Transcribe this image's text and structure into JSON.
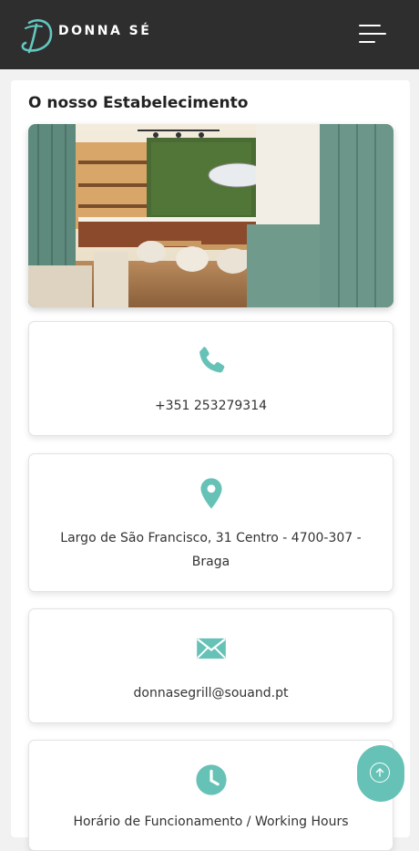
{
  "header": {
    "brand": "DONNA SÉ",
    "logo_icon": "script-d-logo",
    "menu_icon": "hamburger-menu-icon"
  },
  "section": {
    "title": "O nosso Estabelecimento"
  },
  "contacts": [
    {
      "icon": "phone-icon",
      "text": "+351 253279314"
    },
    {
      "icon": "map-pin-icon",
      "text": "Largo de São Francisco, 31 Centro - 4700-307 - Braga"
    },
    {
      "icon": "mail-icon",
      "text": "donnasegrill@souand.pt"
    },
    {
      "icon": "clock-icon",
      "text": "Horário de Funcionamento / Working Hours"
    }
  ],
  "colors": {
    "accent": "#66c2b6",
    "header_bg": "#2e2e2e",
    "text": "#333333"
  },
  "scroll_top_icon": "arrow-up-icon"
}
